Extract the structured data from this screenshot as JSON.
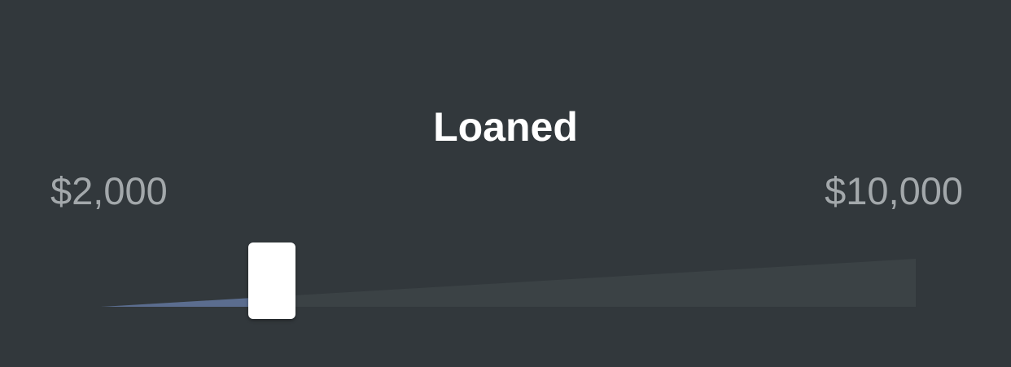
{
  "title": "Loaned",
  "slider": {
    "min_label": "$2,000",
    "max_label": "$10,000",
    "min_value": 2000,
    "max_value": 10000,
    "value_fraction": 0.21
  },
  "colors": {
    "background": "#32383c",
    "track": "#3b4245",
    "fill": "#5b6d8f",
    "thumb": "#ffffff",
    "title": "#ffffff",
    "range_label": "#a3a8ab"
  }
}
